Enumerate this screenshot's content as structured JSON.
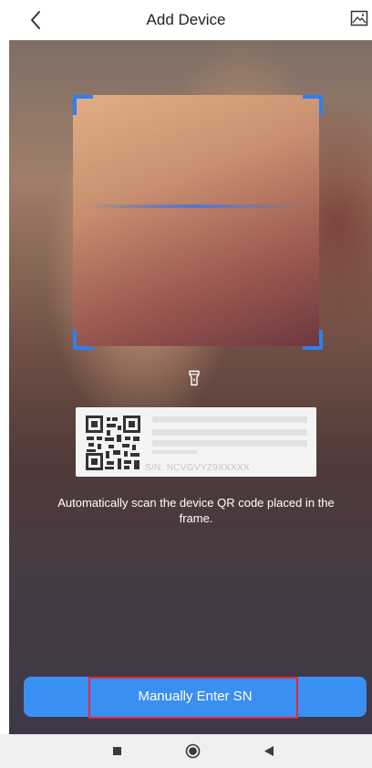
{
  "header": {
    "title": "Add Device",
    "back_icon": "chevron-left-icon",
    "gallery_icon": "image-gallery-icon"
  },
  "scanner": {
    "flashlight_icon": "flashlight-icon",
    "accent_color": "#2f7ff0"
  },
  "sample_label": {
    "sn_text": "S/N: NCVGVYZ9XXXXX"
  },
  "instruction": "Automatically scan the device QR code placed in the frame.",
  "manual_button": {
    "label": "Manually Enter SN",
    "color": "#3a8ff2",
    "highlight_color": "#e8263a"
  },
  "nav_bar": {
    "icons": [
      "square-recents-icon",
      "circle-home-icon",
      "triangle-back-icon"
    ]
  }
}
